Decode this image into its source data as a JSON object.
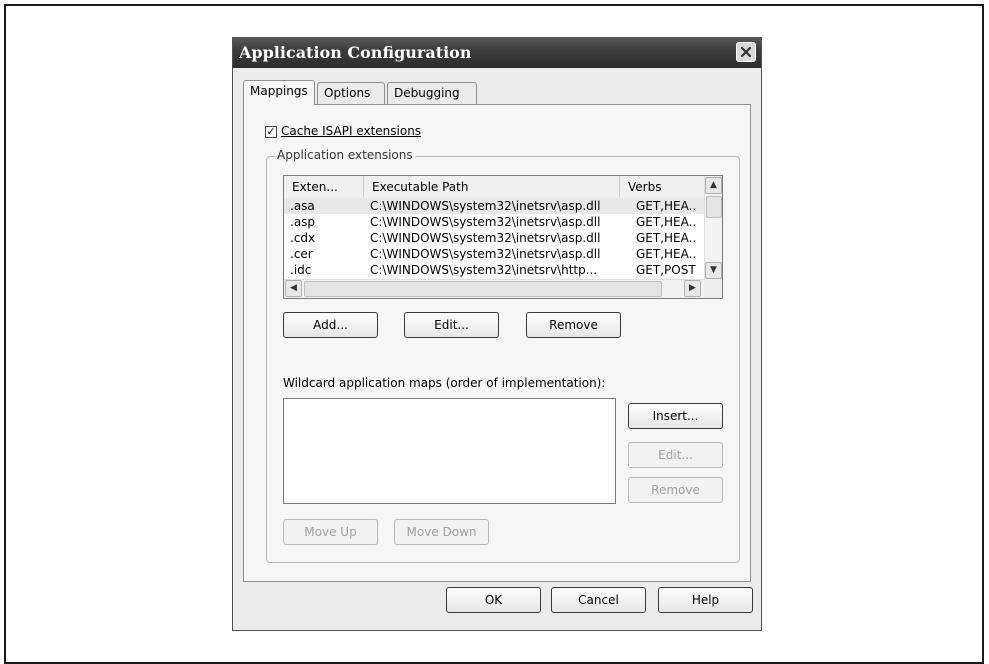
{
  "dialog": {
    "title": "Application Configuration"
  },
  "tabs": [
    {
      "label": "Mappings",
      "active": true
    },
    {
      "label": "Options",
      "active": false
    },
    {
      "label": "Debugging",
      "active": false
    }
  ],
  "cache_isapi": {
    "label": "Cache ISAPI extensions",
    "checked": true
  },
  "app_extensions": {
    "group_label": "Application extensions",
    "columns": [
      "Exten...",
      "Executable Path",
      "Verbs"
    ],
    "rows": [
      {
        "ext": ".asa",
        "path": "C:\\WINDOWS\\system32\\inetsrv\\asp.dll",
        "verbs": "GET,HEA..",
        "selected": true
      },
      {
        "ext": ".asp",
        "path": "C:\\WINDOWS\\system32\\inetsrv\\asp.dll",
        "verbs": "GET,HEA..",
        "selected": false
      },
      {
        "ext": ".cdx",
        "path": "C:\\WINDOWS\\system32\\inetsrv\\asp.dll",
        "verbs": "GET,HEA..",
        "selected": false
      },
      {
        "ext": ".cer",
        "path": "C:\\WINDOWS\\system32\\inetsrv\\asp.dll",
        "verbs": "GET,HEA..",
        "selected": false
      },
      {
        "ext": ".idc",
        "path": "C:\\WINDOWS\\system32\\inetsrv\\http...",
        "verbs": "GET,POST",
        "selected": false
      }
    ],
    "buttons": {
      "add": "Add...",
      "edit": "Edit...",
      "remove": "Remove"
    }
  },
  "wildcard": {
    "label": "Wildcard application maps (order of implementation):",
    "buttons": {
      "insert": "Insert...",
      "edit": "Edit...",
      "remove": "Remove"
    }
  },
  "move": {
    "up": "Move Up",
    "down": "Move Down"
  },
  "footer": {
    "ok": "OK",
    "cancel": "Cancel",
    "help": "Help"
  },
  "icons": {
    "close": "close-icon",
    "scroll_up": "arrow-up-icon",
    "scroll_down": "arrow-down-icon",
    "scroll_left": "arrow-left-icon",
    "scroll_right": "arrow-right-icon"
  },
  "colors": {
    "titlebar": "#3c3c3c",
    "dialog_bg": "#ebebeb",
    "panel_bg": "#f6f6f6"
  }
}
